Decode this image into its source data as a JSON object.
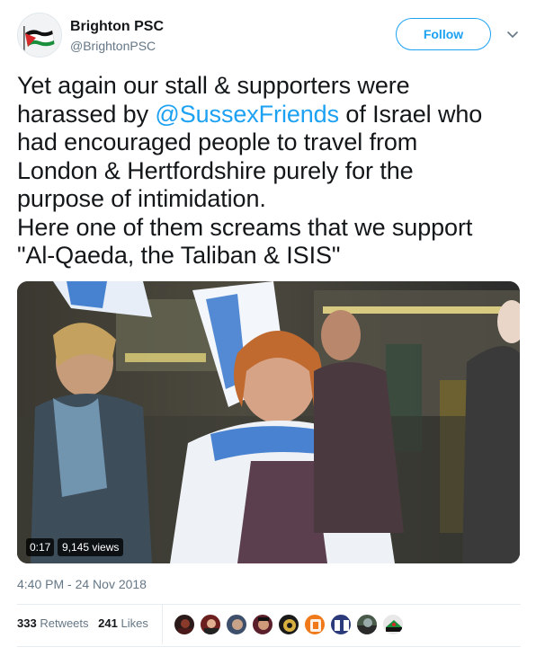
{
  "author": {
    "name": "Brighton PSC",
    "handle": "@BrightonPSC",
    "avatar_icon": "palestine-flag-avatar"
  },
  "follow_button": {
    "label": "Follow"
  },
  "more_menu": {
    "icon": "chevron-down-icon"
  },
  "tweet": {
    "line1": "Yet again our stall & supporters were",
    "line2_pre": "harassed by ",
    "mention": "@SussexFriends",
    "line2_post": " of Israel who",
    "line3": "had encouraged people to travel from",
    "line4": "London & Hertfordshire purely for the",
    "line5": "purpose of intimidation.",
    "line6": "Here one of them screams that we support",
    "line7": "\"Al-Qaeda, the Taliban & ISIS\""
  },
  "video": {
    "duration": "0:17",
    "views": "9,145 views"
  },
  "timestamp": "4:40 PM - 24 Nov 2018",
  "stats": {
    "retweets_count": "333",
    "retweets_label": "Retweets",
    "likes_count": "241",
    "likes_label": "Likes"
  },
  "colors": {
    "accent": "#1da1f2",
    "secondary_text": "#657786",
    "primary_text": "#14171a"
  }
}
